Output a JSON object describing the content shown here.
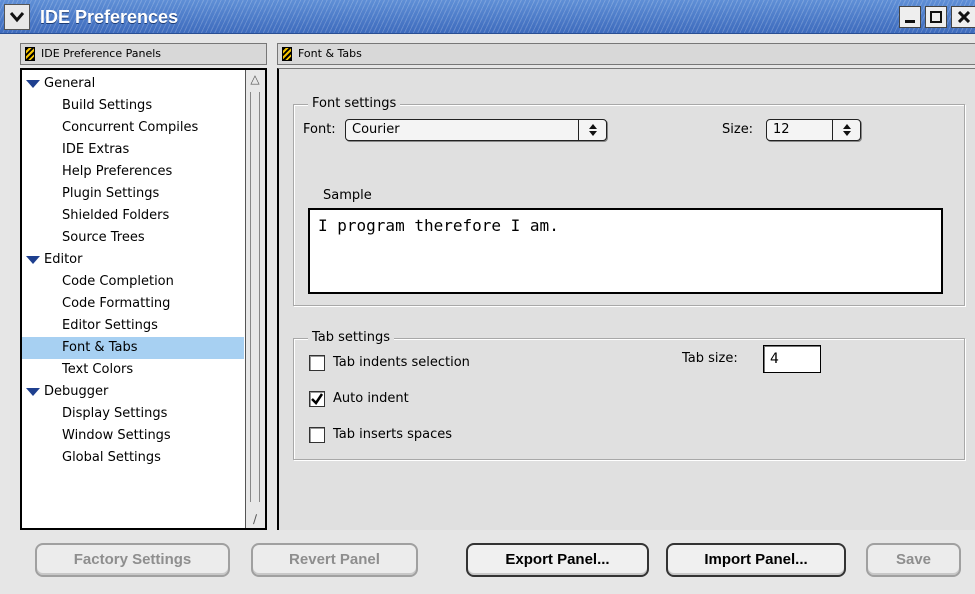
{
  "window": {
    "title": "IDE Preferences"
  },
  "left_panel": {
    "header": "IDE Preference Panels",
    "tree": [
      {
        "label": "General",
        "type": "group"
      },
      {
        "label": "Build Settings",
        "type": "child"
      },
      {
        "label": "Concurrent Compiles",
        "type": "child"
      },
      {
        "label": "IDE Extras",
        "type": "child"
      },
      {
        "label": "Help Preferences",
        "type": "child"
      },
      {
        "label": "Plugin Settings",
        "type": "child"
      },
      {
        "label": "Shielded Folders",
        "type": "child"
      },
      {
        "label": "Source Trees",
        "type": "child"
      },
      {
        "label": "Editor",
        "type": "group"
      },
      {
        "label": "Code Completion",
        "type": "child"
      },
      {
        "label": "Code Formatting",
        "type": "child"
      },
      {
        "label": "Editor Settings",
        "type": "child"
      },
      {
        "label": "Font & Tabs",
        "type": "child",
        "selected": true
      },
      {
        "label": "Text Colors",
        "type": "child"
      },
      {
        "label": "Debugger",
        "type": "group"
      },
      {
        "label": "Display Settings",
        "type": "child"
      },
      {
        "label": "Window Settings",
        "type": "child"
      },
      {
        "label": "Global Settings",
        "type": "child"
      }
    ]
  },
  "right_panel": {
    "header": "Font & Tabs",
    "font_settings": {
      "group_label": "Font settings",
      "font_label": "Font:",
      "font_value": "Courier",
      "size_label": "Size:",
      "size_value": "12"
    },
    "sample": {
      "group_label": "Sample",
      "text": "I program therefore I am."
    },
    "tab_settings": {
      "group_label": "Tab settings",
      "tab_indents_selection": {
        "label": "Tab indents selection",
        "checked": false
      },
      "auto_indent": {
        "label": "Auto indent",
        "checked": true
      },
      "tab_inserts_spaces": {
        "label": "Tab inserts spaces",
        "checked": false
      },
      "tab_size_label": "Tab size:",
      "tab_size_value": "4"
    }
  },
  "buttons": {
    "factory_settings": "Factory Settings",
    "revert_panel": "Revert Panel",
    "export_panel": "Export Panel...",
    "import_panel": "Import Panel...",
    "save": "Save"
  },
  "colors": {
    "titlebar": "#4a78c8",
    "selection": "#a7d0f2",
    "disclosure": "#1e3f8f"
  }
}
